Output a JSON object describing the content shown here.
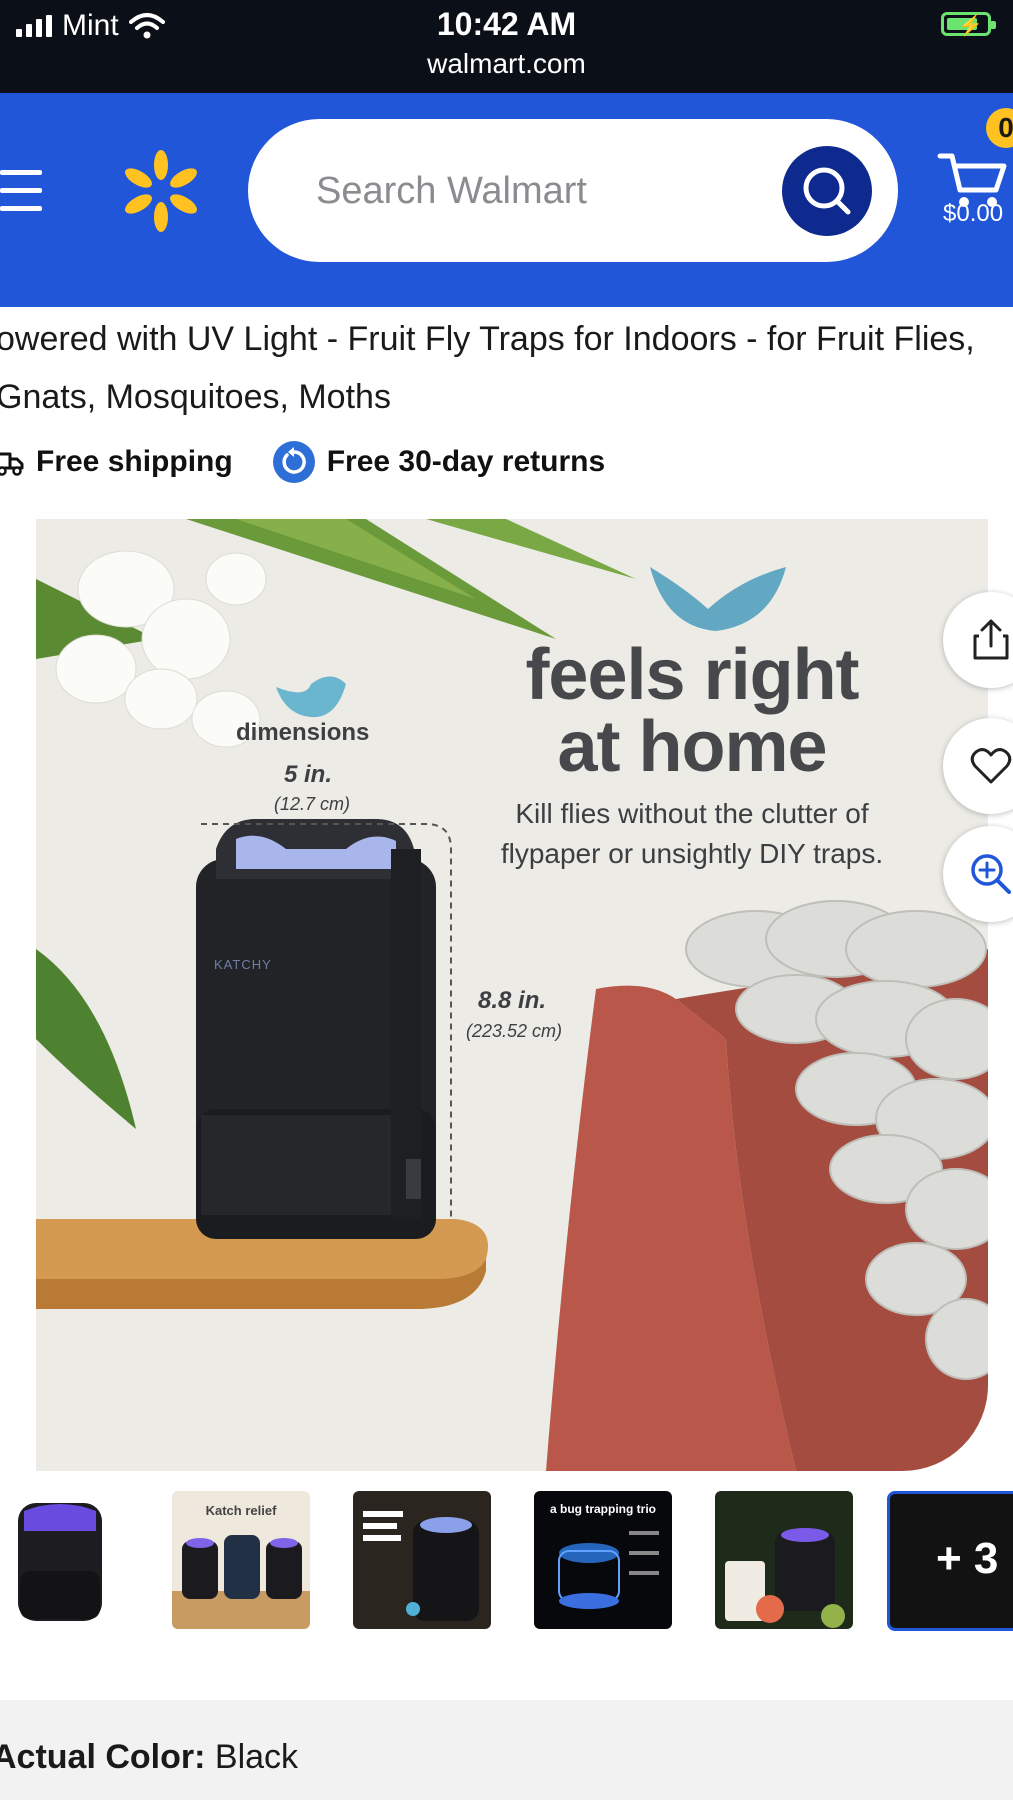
{
  "status_bar": {
    "carrier": "Mint",
    "time": "10:42 AM",
    "url": "walmart.com"
  },
  "header": {
    "search_placeholder": "Search Walmart",
    "cart_count": "0",
    "cart_total": "$0.00",
    "brand_color": "#2156d9",
    "spark_color": "#ffc220"
  },
  "product": {
    "title_line1": "owered with UV Light - Fruit Fly Traps for Indoors - for Fruit Flies,",
    "title_line2": "Gnats, Mosquitoes, Moths",
    "free_shipping": "Free shipping",
    "free_returns": "Free 30-day returns"
  },
  "hero_image": {
    "headline_line1": "feels right",
    "headline_line2": "at home",
    "sub_line1": "Kill flies without the clutter of",
    "sub_line2": "flypaper or unsightly DIY traps.",
    "dimensions_label": "dimensions",
    "width_in": "5 in.",
    "width_cm": "(12.7 cm)",
    "height_in": "8.8 in.",
    "height_cm": "(223.52 cm)",
    "brand": "KATCHY"
  },
  "side_actions": [
    {
      "icon": "share-icon"
    },
    {
      "icon": "heart-icon"
    },
    {
      "icon": "zoom-icon"
    }
  ],
  "thumbnails": {
    "more_label": "+ 3",
    "thumb2_text": "Katch relief",
    "thumb4_text": "a bug trapping trio"
  },
  "color": {
    "label": "Actual Color:",
    "value": "Black"
  }
}
